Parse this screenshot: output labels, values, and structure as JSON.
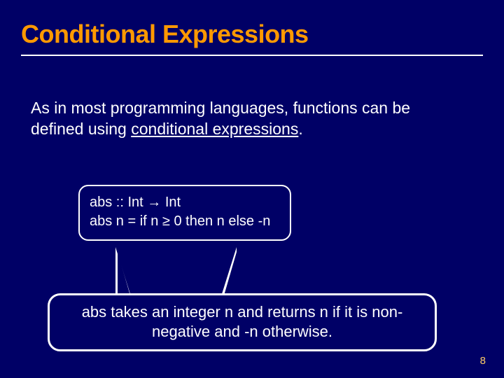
{
  "title": "Conditional Expressions",
  "intro_part1": "As in most programming languages, functions can be defined using ",
  "intro_underlined": "conditional expressions",
  "intro_part2": ".",
  "code_line1": "abs  :: Int → Int",
  "code_line2": "abs n = if n ≥ 0 then n else -n",
  "callout": "abs takes an integer n and returns n if it is non-negative and -n otherwise.",
  "page_number": "8"
}
